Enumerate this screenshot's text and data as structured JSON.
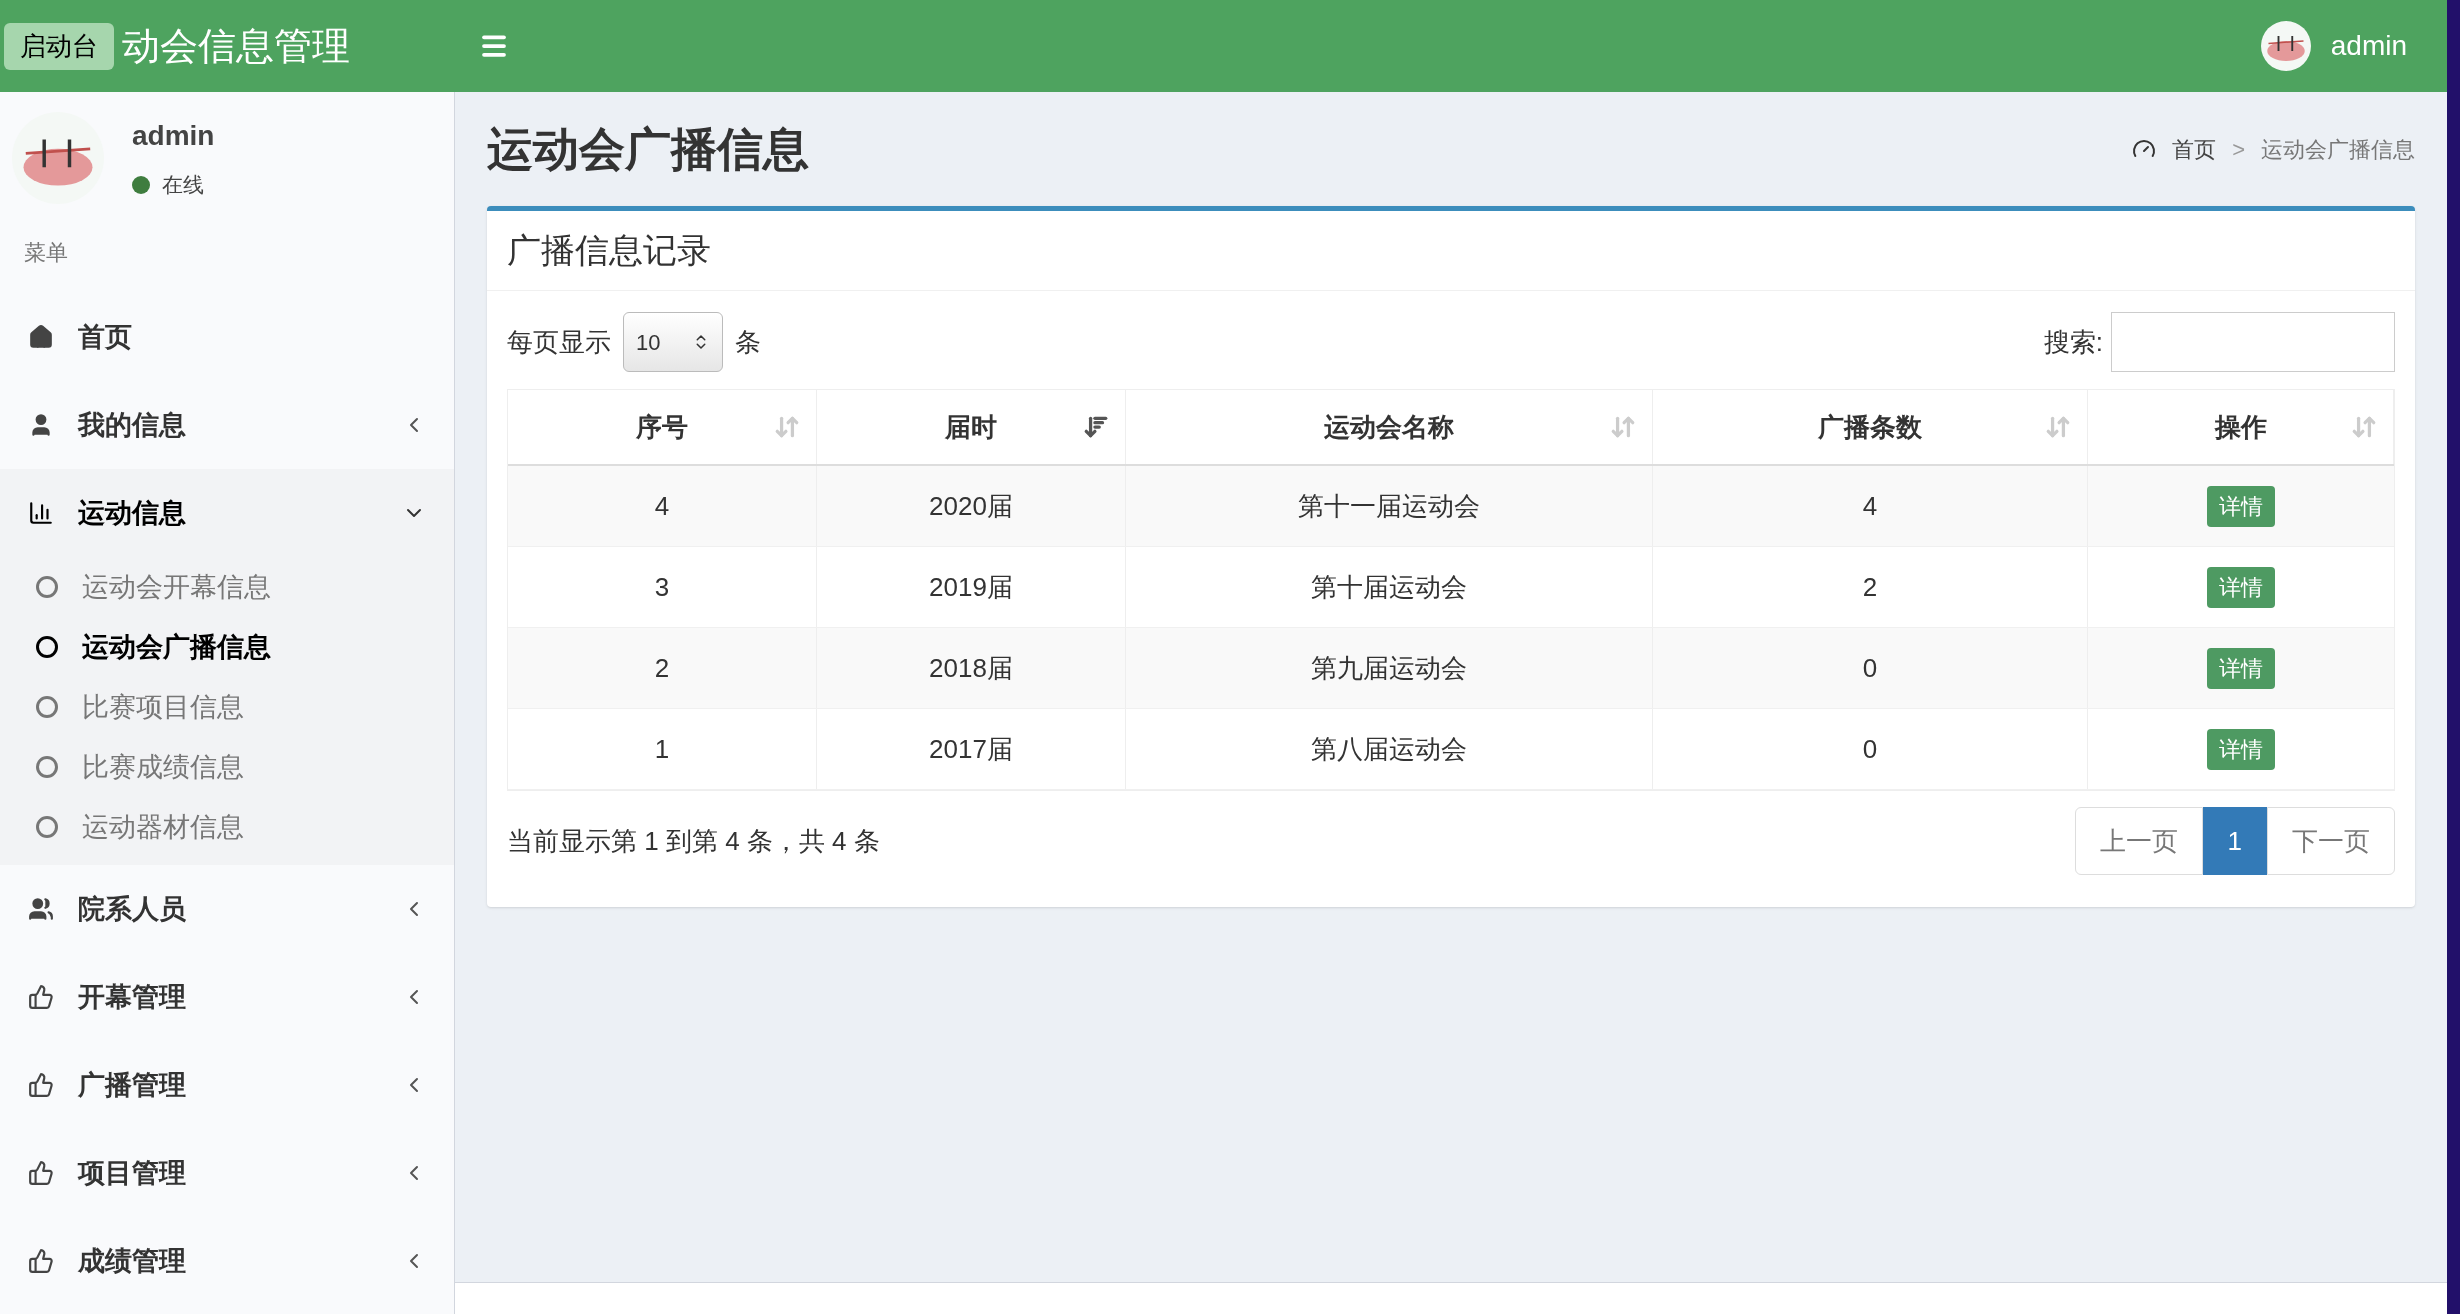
{
  "launcher_tooltip": "启动台",
  "header": {
    "title": "动会信息管理",
    "user": "admin"
  },
  "user_panel": {
    "name": "admin",
    "status": "在线"
  },
  "sidebar": {
    "heading": "菜单",
    "items": [
      {
        "label": "首页"
      },
      {
        "label": "我的信息",
        "expanded": false
      },
      {
        "label": "运动信息",
        "expanded": true,
        "children": [
          {
            "label": "运动会开幕信息",
            "selected": false
          },
          {
            "label": "运动会广播信息",
            "selected": true
          },
          {
            "label": "比赛项目信息",
            "selected": false
          },
          {
            "label": "比赛成绩信息",
            "selected": false
          },
          {
            "label": "运动器材信息",
            "selected": false
          }
        ]
      },
      {
        "label": "院系人员",
        "expanded": false
      },
      {
        "label": "开幕管理",
        "expanded": false
      },
      {
        "label": "广播管理",
        "expanded": false
      },
      {
        "label": "项目管理",
        "expanded": false
      },
      {
        "label": "成绩管理",
        "expanded": false
      }
    ]
  },
  "page": {
    "title": "运动会广播信息",
    "breadcrumb": [
      "首页",
      "运动会广播信息"
    ],
    "breadcrumb_separator": ">"
  },
  "box": {
    "title": "广播信息记录",
    "length_label_before": "每页显示",
    "length_value": "10",
    "length_label_after": "条",
    "search_label": "搜索:"
  },
  "table": {
    "columns": [
      {
        "label": "序号",
        "sorted": false
      },
      {
        "label": "届时",
        "sorted": true
      },
      {
        "label": "运动会名称",
        "sorted": false
      },
      {
        "label": "广播条数",
        "sorted": false
      },
      {
        "label": "操作",
        "sorted": false
      }
    ],
    "rows": [
      {
        "cells": [
          "4",
          "2020届",
          "第十一届运动会",
          "4"
        ],
        "action": "详情"
      },
      {
        "cells": [
          "3",
          "2019届",
          "第十届运动会",
          "2"
        ],
        "action": "详情"
      },
      {
        "cells": [
          "2",
          "2018届",
          "第九届运动会",
          "0"
        ],
        "action": "详情"
      },
      {
        "cells": [
          "1",
          "2017届",
          "第八届运动会",
          "0"
        ],
        "action": "详情"
      }
    ]
  },
  "info": "当前显示第 1 到第 4 条，共 4 条",
  "pagination": [
    {
      "label": "上一页",
      "selected": false
    },
    {
      "label": "1",
      "selected": true
    },
    {
      "label": "下一页",
      "selected": false
    }
  ]
}
